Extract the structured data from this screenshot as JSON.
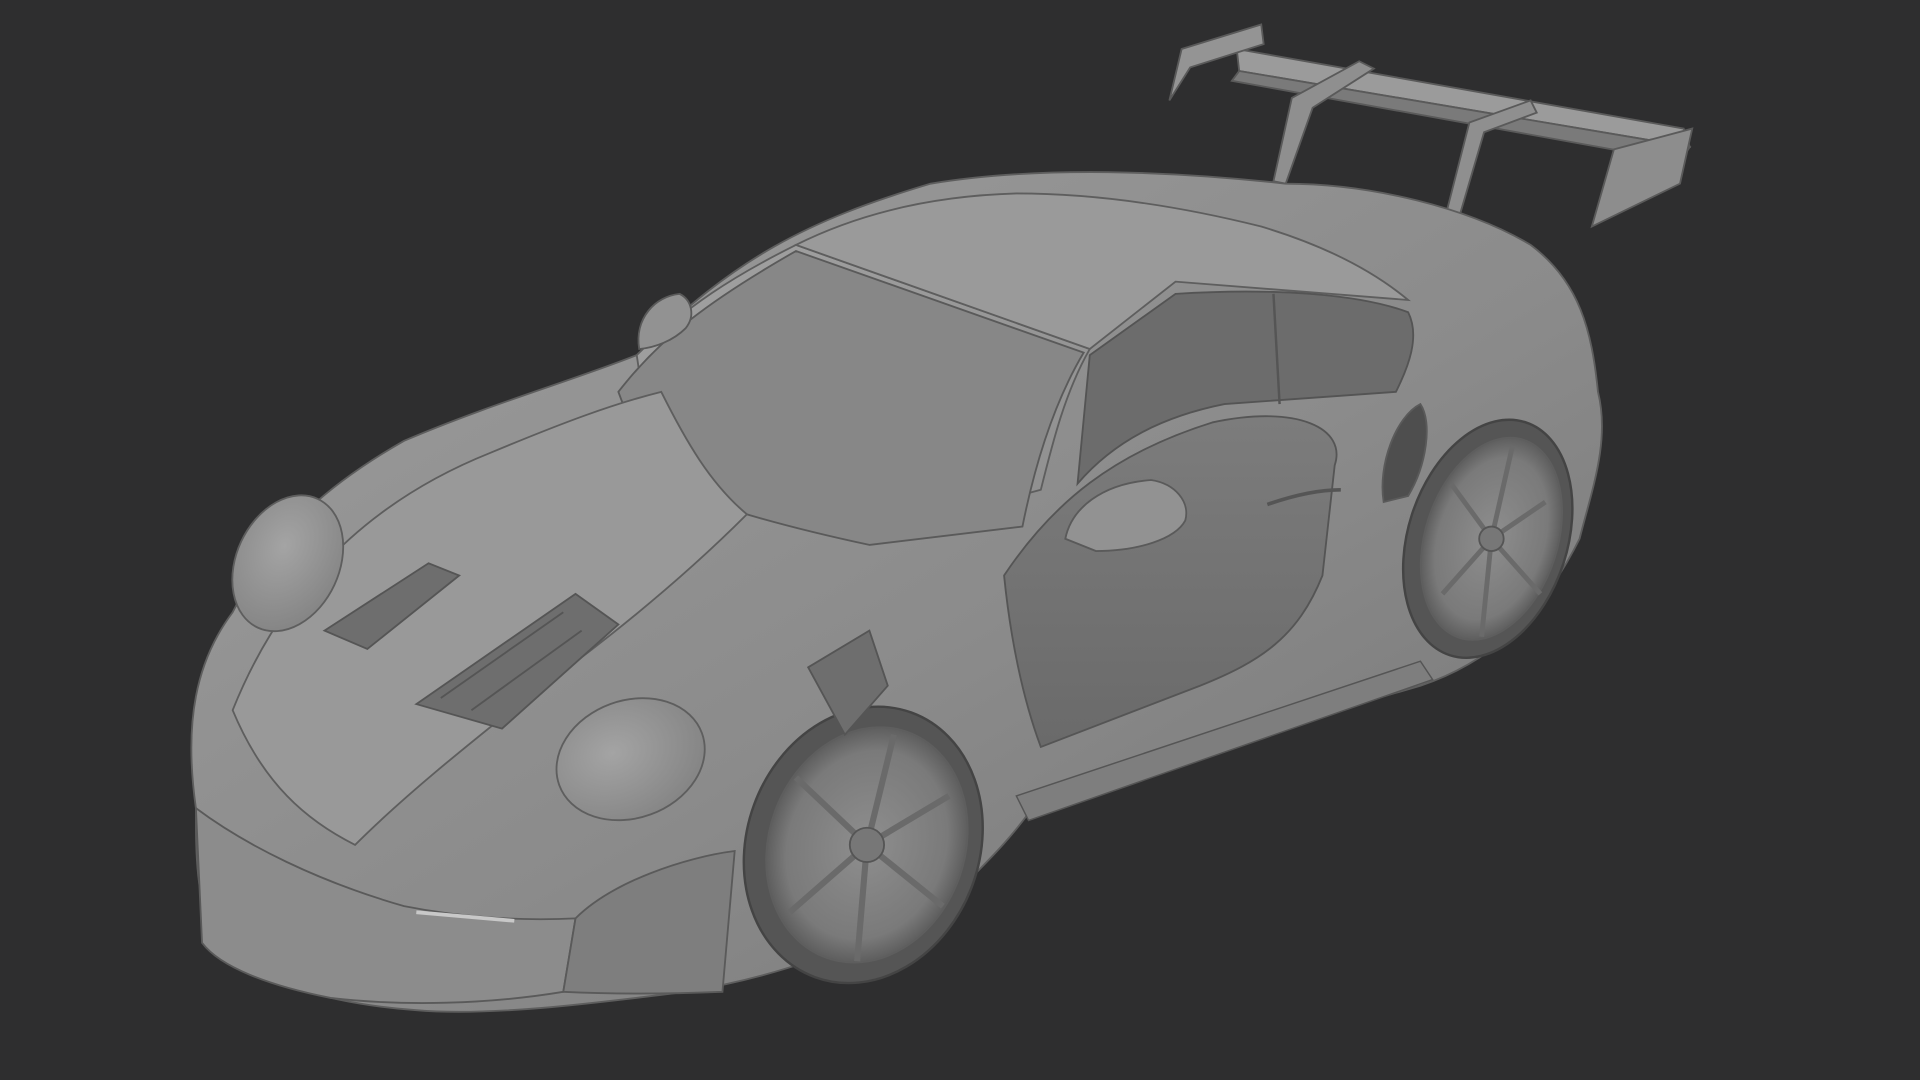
{
  "scene": {
    "background_color": "#2e2e2f",
    "model_color": "#8a8a8a",
    "subject": "car-model-clay-render"
  }
}
